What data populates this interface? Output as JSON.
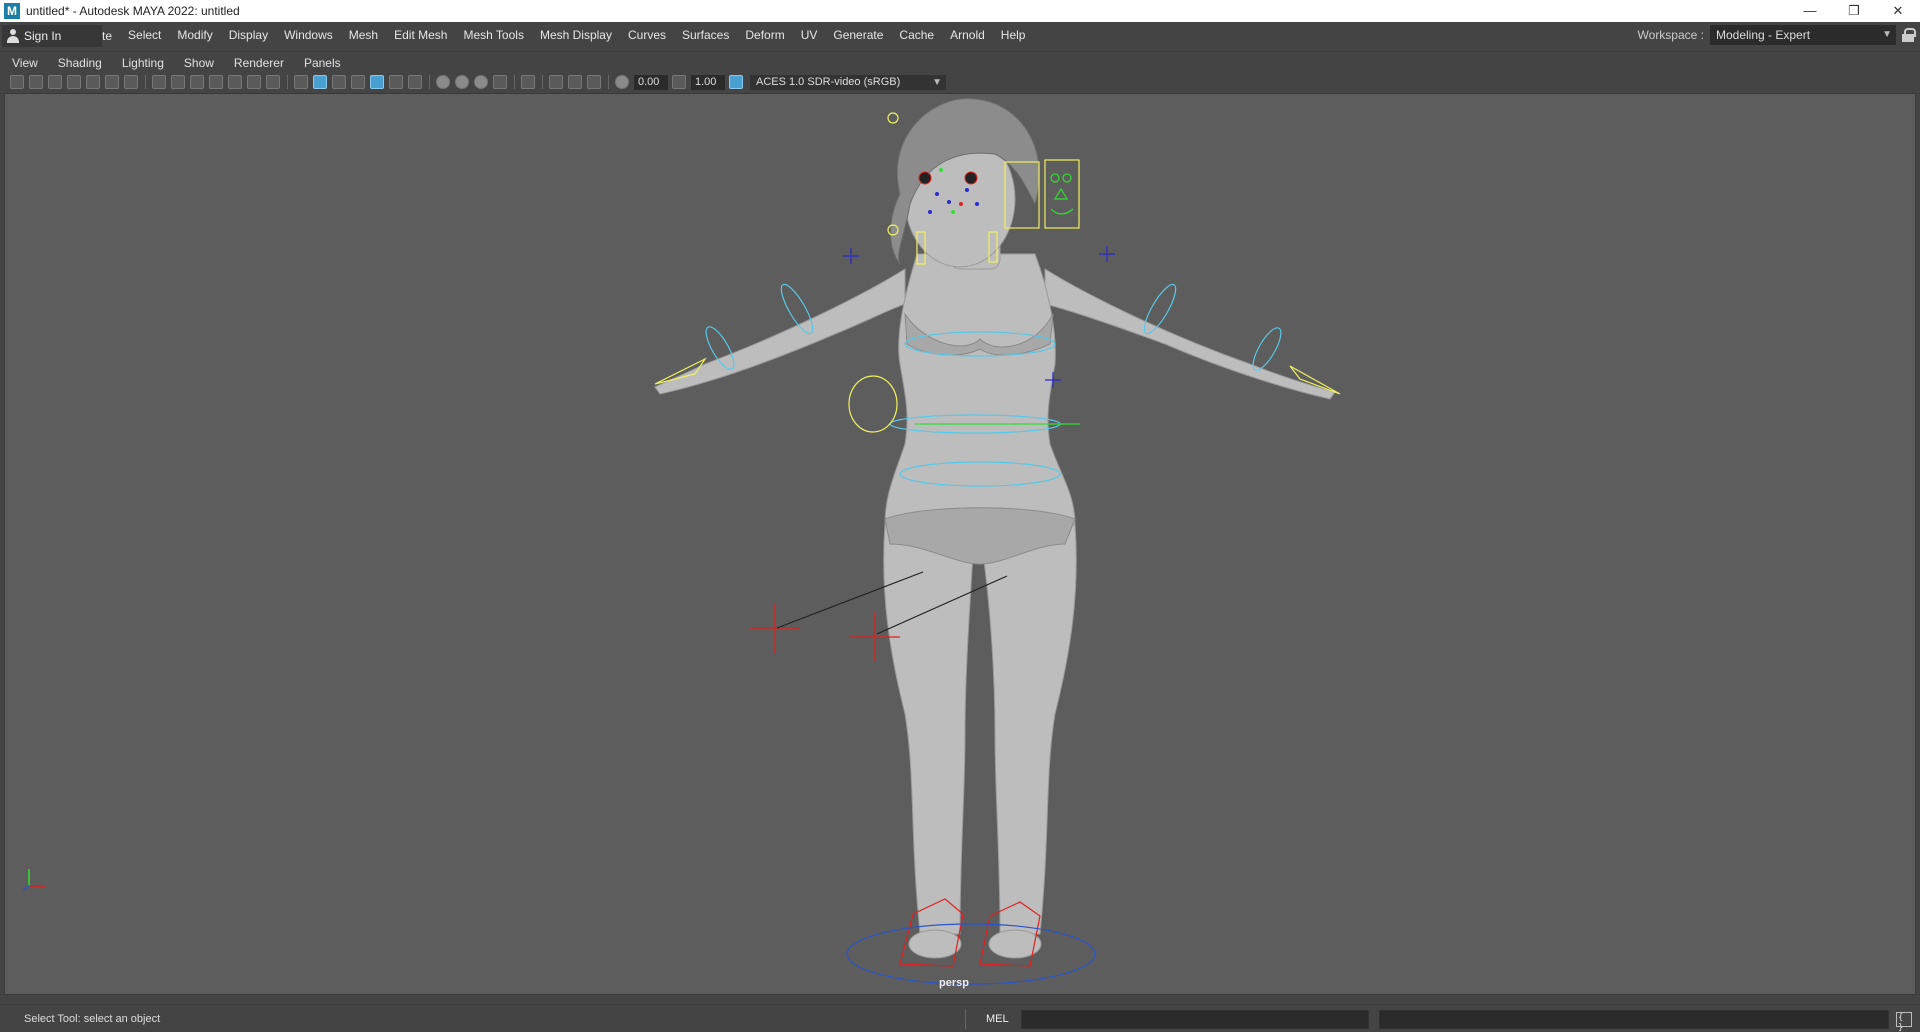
{
  "window": {
    "title": "untitled* - Autodesk MAYA 2022: untitled",
    "logo_letter": "M",
    "minimize_glyph": "—",
    "restore_glyph": "❐",
    "close_glyph": "✕"
  },
  "menubar": {
    "sign_in": "Sign In",
    "hidden_fragment": "te",
    "items": [
      "Select",
      "Modify",
      "Display",
      "Windows",
      "Mesh",
      "Edit Mesh",
      "Mesh Tools",
      "Mesh Display",
      "Curves",
      "Surfaces",
      "Deform",
      "UV",
      "Generate",
      "Cache",
      "Arnold",
      "Help"
    ],
    "workspace_label": "Workspace :",
    "workspace_value": "Modeling - Expert"
  },
  "panel_menu": {
    "items": [
      "View",
      "Shading",
      "Lighting",
      "Show",
      "Renderer",
      "Panels"
    ]
  },
  "toolbar": {
    "exposure": "0.00",
    "gamma": "1.00",
    "color_space": "ACES 1.0 SDR-video (sRGB)"
  },
  "viewport": {
    "camera": "persp",
    "background": "#5d5d5d"
  },
  "statusbar": {
    "help_line": "Select Tool: select an object",
    "mel_label": "MEL"
  },
  "colors": {
    "rig_cyan": "#58c8e8",
    "rig_yellow": "#f0f060",
    "rig_red": "#e02020",
    "rig_blue": "#2a2ad0",
    "rig_green": "#30e030",
    "mesh": "#bdbdbd"
  }
}
